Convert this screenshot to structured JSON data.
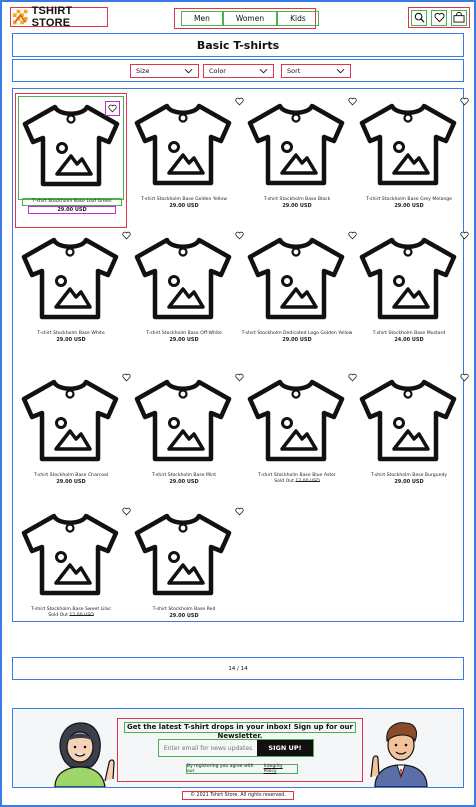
{
  "header": {
    "logo_text": "TSHIRT STORE",
    "nav": [
      "Men",
      "Women",
      "Kids"
    ],
    "icons": [
      "search-icon",
      "heart-icon",
      "cart-icon"
    ]
  },
  "page": {
    "title": "Basic T-shirts"
  },
  "filters": {
    "size": "Size",
    "color": "Color",
    "sort": "Sort"
  },
  "products": [
    {
      "name": "T-shirt Stockholm Base Leaf Green",
      "price": "29.00 USD"
    },
    {
      "name": "T-shirt Stockholm Base Golden Yellow",
      "price": "29.00 USD"
    },
    {
      "name": "T-shirt Stockholm Base Black",
      "price": "29.00 USD"
    },
    {
      "name": "T-shirt Stockholm Base Grey Melange",
      "price": "29.00 USD"
    },
    {
      "name": "T-shirt Stockholm Base White",
      "price": "29.00 USD"
    },
    {
      "name": "T-shirt Stockholm Base Off-White",
      "price": "29.00 USD"
    },
    {
      "name": "T-shirt Stockholm Dedicated Logo Golden Yellow",
      "price": "29.00 USD"
    },
    {
      "name": "T-shirt Stockholm Base Mustard",
      "price": "24.00 USD"
    },
    {
      "name": "T-shirt Stockholm Base Charcoal",
      "price": "29.00 USD"
    },
    {
      "name": "T-shirt Stockholm Base Mint",
      "price": "29.00 USD"
    },
    {
      "name": "T-shirt Stockholm Base Blue Aster",
      "price": "",
      "status": "Sold Out",
      "old_price": "12.00 USD"
    },
    {
      "name": "T-shirt Stockholm Base Burgundy",
      "price": "29.00 USD"
    },
    {
      "name": "T-shirt Stockholm Base Sweet Lilac",
      "price": "",
      "status": "Sold Out",
      "old_price": "12.00 USD"
    },
    {
      "name": "T-shirt Stockholm Base Red",
      "price": "29.00 USD"
    }
  ],
  "pagination": {
    "text": "14 / 14"
  },
  "newsletter": {
    "heading": "Get the latest T-shirt drops in your inbox! Sign up for our Newsletter.",
    "placeholder": "Enter email for news updates",
    "button": "SIGN UP!",
    "note": "By registering you agree with our",
    "policy_link": "Integrity Policy"
  },
  "footer": {
    "copyright": "© 2021 Tshirt Store. All rights reserved."
  },
  "colors": {
    "accent_red": "#e0344a",
    "accent_green": "#4caf50",
    "accent_blue": "#3b7be6",
    "accent_magenta": "#c02ad0"
  }
}
